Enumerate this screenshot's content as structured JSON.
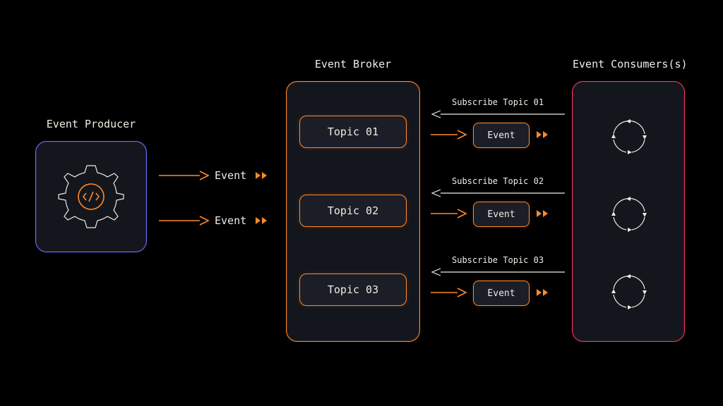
{
  "producer": {
    "title": "Event Producer"
  },
  "broker": {
    "title": "Event Broker",
    "topics": [
      "Topic 01",
      "Topic 02",
      "Topic 03"
    ]
  },
  "consumers": {
    "title": "Event Consumers(s)"
  },
  "flow": {
    "producer_events": [
      "Event",
      "Event"
    ],
    "subscribe": [
      "Subscribe Topic 01",
      "Subscribe Topic 02",
      "Subscribe Topic 03"
    ],
    "delivered_events": [
      "Event",
      "Event",
      "Event"
    ]
  },
  "colors": {
    "bg": "#000000",
    "panel": "#14161d",
    "producer_border": "#6a6cff",
    "broker_accent": "#ff8a2a",
    "consumer_border": "#ff3366",
    "text": "#f0ece4"
  }
}
